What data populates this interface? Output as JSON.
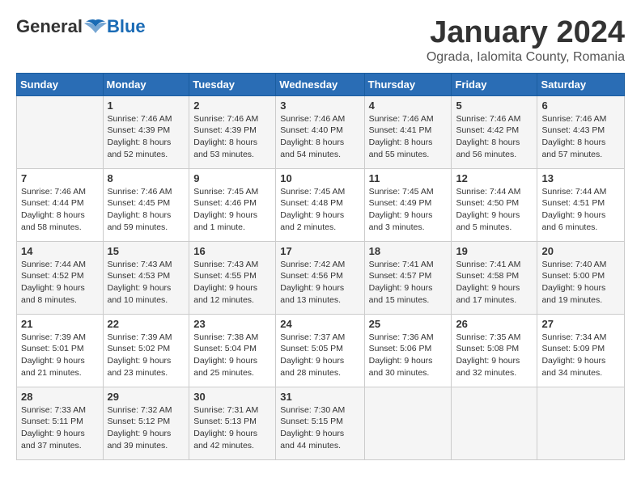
{
  "logo": {
    "general": "General",
    "blue": "Blue"
  },
  "title": "January 2024",
  "subtitle": "Ograda, Ialomita County, Romania",
  "weekdays": [
    "Sunday",
    "Monday",
    "Tuesday",
    "Wednesday",
    "Thursday",
    "Friday",
    "Saturday"
  ],
  "weeks": [
    [
      {
        "day": "",
        "info": ""
      },
      {
        "day": "1",
        "info": "Sunrise: 7:46 AM\nSunset: 4:39 PM\nDaylight: 8 hours\nand 52 minutes."
      },
      {
        "day": "2",
        "info": "Sunrise: 7:46 AM\nSunset: 4:39 PM\nDaylight: 8 hours\nand 53 minutes."
      },
      {
        "day": "3",
        "info": "Sunrise: 7:46 AM\nSunset: 4:40 PM\nDaylight: 8 hours\nand 54 minutes."
      },
      {
        "day": "4",
        "info": "Sunrise: 7:46 AM\nSunset: 4:41 PM\nDaylight: 8 hours\nand 55 minutes."
      },
      {
        "day": "5",
        "info": "Sunrise: 7:46 AM\nSunset: 4:42 PM\nDaylight: 8 hours\nand 56 minutes."
      },
      {
        "day": "6",
        "info": "Sunrise: 7:46 AM\nSunset: 4:43 PM\nDaylight: 8 hours\nand 57 minutes."
      }
    ],
    [
      {
        "day": "7",
        "info": "Sunrise: 7:46 AM\nSunset: 4:44 PM\nDaylight: 8 hours\nand 58 minutes."
      },
      {
        "day": "8",
        "info": "Sunrise: 7:46 AM\nSunset: 4:45 PM\nDaylight: 8 hours\nand 59 minutes."
      },
      {
        "day": "9",
        "info": "Sunrise: 7:45 AM\nSunset: 4:46 PM\nDaylight: 9 hours\nand 1 minute."
      },
      {
        "day": "10",
        "info": "Sunrise: 7:45 AM\nSunset: 4:48 PM\nDaylight: 9 hours\nand 2 minutes."
      },
      {
        "day": "11",
        "info": "Sunrise: 7:45 AM\nSunset: 4:49 PM\nDaylight: 9 hours\nand 3 minutes."
      },
      {
        "day": "12",
        "info": "Sunrise: 7:44 AM\nSunset: 4:50 PM\nDaylight: 9 hours\nand 5 minutes."
      },
      {
        "day": "13",
        "info": "Sunrise: 7:44 AM\nSunset: 4:51 PM\nDaylight: 9 hours\nand 6 minutes."
      }
    ],
    [
      {
        "day": "14",
        "info": "Sunrise: 7:44 AM\nSunset: 4:52 PM\nDaylight: 9 hours\nand 8 minutes."
      },
      {
        "day": "15",
        "info": "Sunrise: 7:43 AM\nSunset: 4:53 PM\nDaylight: 9 hours\nand 10 minutes."
      },
      {
        "day": "16",
        "info": "Sunrise: 7:43 AM\nSunset: 4:55 PM\nDaylight: 9 hours\nand 12 minutes."
      },
      {
        "day": "17",
        "info": "Sunrise: 7:42 AM\nSunset: 4:56 PM\nDaylight: 9 hours\nand 13 minutes."
      },
      {
        "day": "18",
        "info": "Sunrise: 7:41 AM\nSunset: 4:57 PM\nDaylight: 9 hours\nand 15 minutes."
      },
      {
        "day": "19",
        "info": "Sunrise: 7:41 AM\nSunset: 4:58 PM\nDaylight: 9 hours\nand 17 minutes."
      },
      {
        "day": "20",
        "info": "Sunrise: 7:40 AM\nSunset: 5:00 PM\nDaylight: 9 hours\nand 19 minutes."
      }
    ],
    [
      {
        "day": "21",
        "info": "Sunrise: 7:39 AM\nSunset: 5:01 PM\nDaylight: 9 hours\nand 21 minutes."
      },
      {
        "day": "22",
        "info": "Sunrise: 7:39 AM\nSunset: 5:02 PM\nDaylight: 9 hours\nand 23 minutes."
      },
      {
        "day": "23",
        "info": "Sunrise: 7:38 AM\nSunset: 5:04 PM\nDaylight: 9 hours\nand 25 minutes."
      },
      {
        "day": "24",
        "info": "Sunrise: 7:37 AM\nSunset: 5:05 PM\nDaylight: 9 hours\nand 28 minutes."
      },
      {
        "day": "25",
        "info": "Sunrise: 7:36 AM\nSunset: 5:06 PM\nDaylight: 9 hours\nand 30 minutes."
      },
      {
        "day": "26",
        "info": "Sunrise: 7:35 AM\nSunset: 5:08 PM\nDaylight: 9 hours\nand 32 minutes."
      },
      {
        "day": "27",
        "info": "Sunrise: 7:34 AM\nSunset: 5:09 PM\nDaylight: 9 hours\nand 34 minutes."
      }
    ],
    [
      {
        "day": "28",
        "info": "Sunrise: 7:33 AM\nSunset: 5:11 PM\nDaylight: 9 hours\nand 37 minutes."
      },
      {
        "day": "29",
        "info": "Sunrise: 7:32 AM\nSunset: 5:12 PM\nDaylight: 9 hours\nand 39 minutes."
      },
      {
        "day": "30",
        "info": "Sunrise: 7:31 AM\nSunset: 5:13 PM\nDaylight: 9 hours\nand 42 minutes."
      },
      {
        "day": "31",
        "info": "Sunrise: 7:30 AM\nSunset: 5:15 PM\nDaylight: 9 hours\nand 44 minutes."
      },
      {
        "day": "",
        "info": ""
      },
      {
        "day": "",
        "info": ""
      },
      {
        "day": "",
        "info": ""
      }
    ]
  ]
}
